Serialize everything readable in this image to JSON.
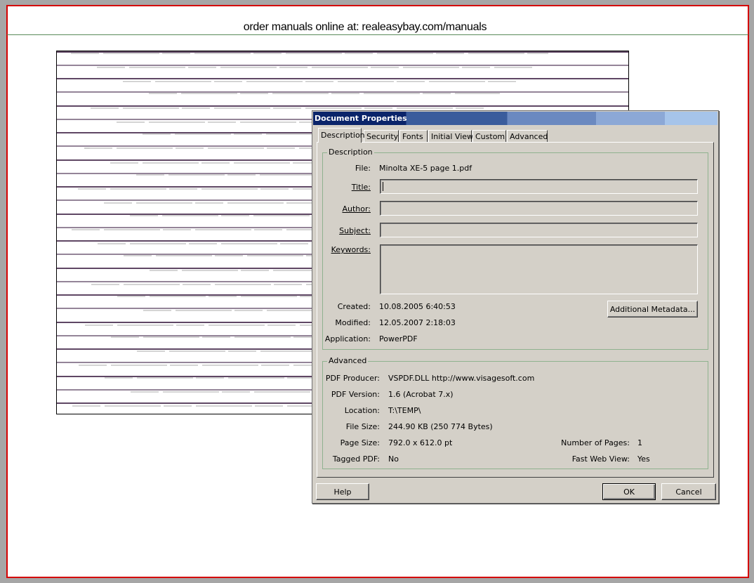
{
  "header": {
    "text": "order manuals online at:  realeasybay.com/manuals"
  },
  "dialog": {
    "title": "Document Properties",
    "tabs": [
      {
        "label": "Description",
        "active": true
      },
      {
        "label": "Security"
      },
      {
        "label": "Fonts"
      },
      {
        "label": "Initial View"
      },
      {
        "label": "Custom"
      },
      {
        "label": "Advanced"
      }
    ],
    "description": {
      "group_title": "Description",
      "file_label": "File:",
      "file_value": "Minolta XE-5 page 1.pdf",
      "title_label": "Title:",
      "title_value": "",
      "author_label": "Author:",
      "author_value": "",
      "subject_label": "Subject:",
      "subject_value": "",
      "keywords_label": "Keywords:",
      "keywords_value": "",
      "created_label": "Created:",
      "created_value": "10.08.2005 6:40:53",
      "modified_label": "Modified:",
      "modified_value": "12.05.2007 2:18:03",
      "application_label": "Application:",
      "application_value": "PowerPDF",
      "metadata_button": "Additional Metadata..."
    },
    "advanced": {
      "group_title": "Advanced",
      "producer_label": "PDF Producer:",
      "producer_value": "VSPDF.DLL http://www.visagesoft.com",
      "version_label": "PDF Version:",
      "version_value": "1.6 (Acrobat 7.x)",
      "location_label": "Location:",
      "location_value": "T:\\TEMP\\",
      "filesize_label": "File Size:",
      "filesize_value": "244.90 KB (250 774 Bytes)",
      "pagesize_label": "Page Size:",
      "pagesize_value": "792.0 x 612.0 pt",
      "pages_label": "Number of Pages:",
      "pages_value": "1",
      "tagged_label": "Tagged PDF:",
      "tagged_value": "No",
      "fastweb_label": "Fast Web View:",
      "fastweb_value": "Yes"
    },
    "buttons": {
      "help": "Help",
      "ok": "OK",
      "cancel": "Cancel"
    }
  }
}
